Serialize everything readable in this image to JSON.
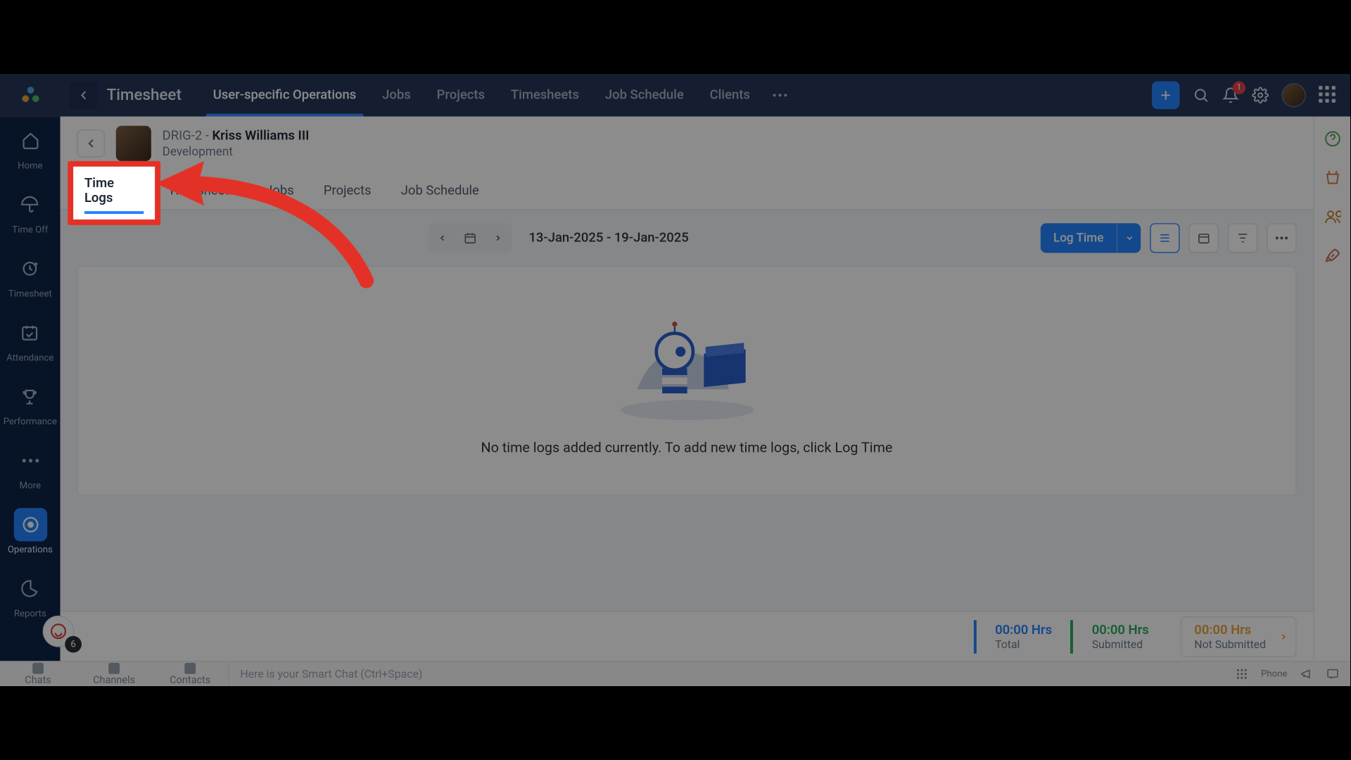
{
  "header": {
    "module": "Timesheet",
    "tabs": [
      "User-specific Operations",
      "Jobs",
      "Projects",
      "Timesheets",
      "Job Schedule",
      "Clients"
    ],
    "active_tab_index": 0,
    "notif_badge": "1"
  },
  "sidebar": {
    "items": [
      {
        "label": "Home"
      },
      {
        "label": "Time Off"
      },
      {
        "label": "Timesheet"
      },
      {
        "label": "Attendance"
      },
      {
        "label": "Performance"
      },
      {
        "label": "More"
      },
      {
        "label": "Operations"
      },
      {
        "label": "Reports"
      }
    ],
    "active_index": 6
  },
  "user": {
    "code": "DRIG-2",
    "name": "Kriss Williams III",
    "dept": "Development"
  },
  "subtabs": {
    "items": [
      "Time Logs",
      "Timesheets",
      "Jobs",
      "Projects",
      "Job Schedule"
    ],
    "active_index": 0
  },
  "toolbar": {
    "date_range": "13-Jan-2025 - 19-Jan-2025",
    "log_time_label": "Log Time"
  },
  "empty": {
    "message": "No time logs added currently. To add new time logs, click Log Time"
  },
  "summary": {
    "total": {
      "hrs": "00:00 Hrs",
      "label": "Total"
    },
    "submitted": {
      "hrs": "00:00 Hrs",
      "label": "Submitted"
    },
    "not_submitted": {
      "hrs": "00:00 Hrs",
      "label": "Not Submitted"
    }
  },
  "bottombar": {
    "tabs": [
      "Chats",
      "Channels",
      "Contacts"
    ],
    "search_placeholder": "Here is your Smart Chat (Ctrl+Space)",
    "phone_label": "Phone"
  },
  "chatfloat": {
    "count": "6"
  },
  "annotation": {
    "highlight_label": "Time Logs"
  }
}
